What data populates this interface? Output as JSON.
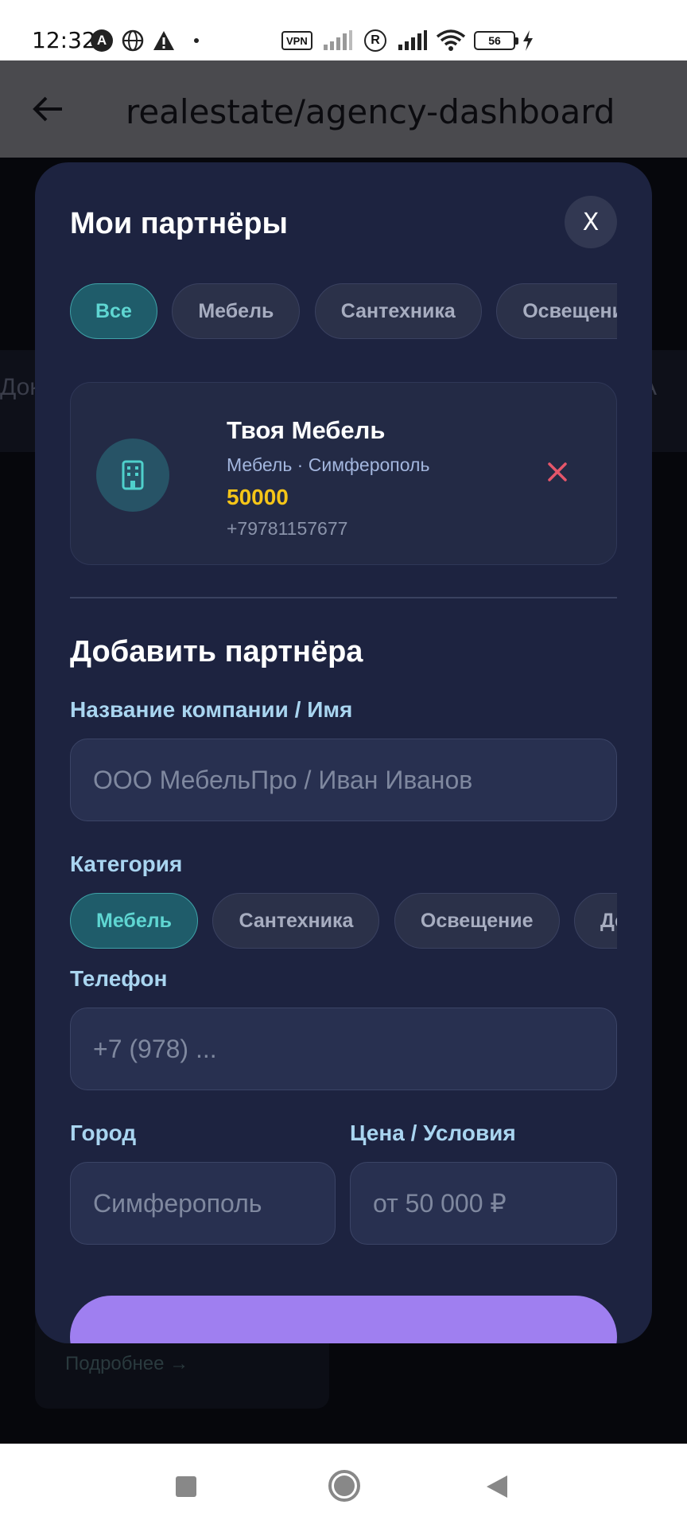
{
  "status_bar": {
    "time": "12:32",
    "vpn_label": "VPN",
    "roaming_label": "R",
    "battery_level": "56"
  },
  "app_bar": {
    "title": "realestate/agency-dashboard"
  },
  "background": {
    "left_text": "Док",
    "right_text": "А",
    "link_text": "Подробнее →"
  },
  "modal": {
    "title": "Мои партнёры",
    "close_label": "X",
    "filter_chips": [
      {
        "label": "Все",
        "active": true
      },
      {
        "label": "Мебель",
        "active": false
      },
      {
        "label": "Сантехника",
        "active": false
      },
      {
        "label": "Освещени",
        "active": false
      }
    ],
    "partners": [
      {
        "name": "Твоя Мебель",
        "meta": "Мебель · Симферополь",
        "price": "50000",
        "phone": "+79781157677"
      }
    ],
    "add_form": {
      "title": "Добавить партнёра",
      "name_label": "Название компании / Имя",
      "name_placeholder": "ООО МебельПро / Иван Иванов",
      "category_label": "Категория",
      "category_chips": [
        {
          "label": "Мебель",
          "active": true
        },
        {
          "label": "Сантехника",
          "active": false
        },
        {
          "label": "Освещение",
          "active": false
        },
        {
          "label": "Де",
          "active": false
        }
      ],
      "phone_label": "Телефон",
      "phone_placeholder": "+7 (978) ...",
      "city_label": "Город",
      "city_placeholder": "Симферополь",
      "price_label": "Цена / Условия",
      "price_placeholder": "от 50 000 ₽"
    }
  },
  "colors": {
    "modal_bg": "#1d2340",
    "accent_teal": "#5fd6d2",
    "price_yellow": "#f5c518",
    "remove_red": "#e5566a",
    "submit_purple": "#9f7ff0"
  }
}
